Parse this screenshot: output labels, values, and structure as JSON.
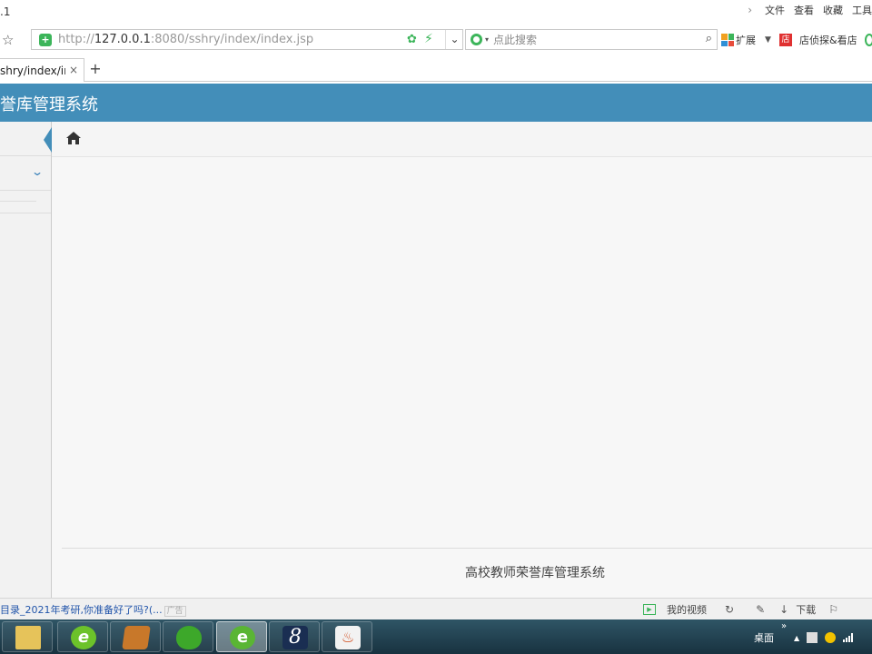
{
  "browser": {
    "window_title": ".1",
    "menu": [
      "文件",
      "查看",
      "收藏",
      "工具"
    ],
    "url_prefix": "http://",
    "url_host": "127.0.0.1",
    "url_rest": ":8080/sshry/index/index.jsp",
    "search_placeholder": "点此搜索",
    "extensions_label": "扩展",
    "shop_label": "店侦探&看店",
    "tab_label": "shry/index/ind",
    "tab_close": "×",
    "new_tab": "+"
  },
  "app": {
    "title": "誉库管理系统",
    "header_color": "#438eb9",
    "footer_text": "高校教师荣誉库管理系统"
  },
  "statusbar": {
    "news_text": "目录_2021年考研,你准备好了吗?(...",
    "ad_label": "广告",
    "video_label": "我的视频",
    "download_label": "下载"
  },
  "taskbar": {
    "desktop_label": "桌面",
    "expand_label": "»",
    "apps": [
      "file-explorer",
      "dreamweaver",
      "book",
      "paw-app",
      "browser",
      "eight-app",
      "java"
    ]
  }
}
